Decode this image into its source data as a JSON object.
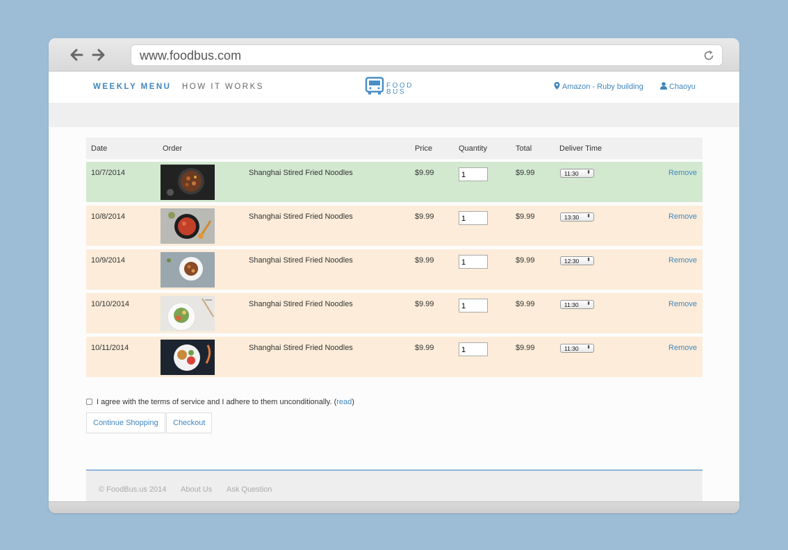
{
  "browser": {
    "url": "www.foodbus.com"
  },
  "header": {
    "menu_weekly": "WEEKLY MENU",
    "menu_how": "HOW IT WORKS",
    "logo_line1": "FOOD",
    "logo_line2": "BUS",
    "location": "Amazon - Ruby building",
    "user": "Chaoyu"
  },
  "table": {
    "headers": {
      "date": "Date",
      "order": "Order",
      "price": "Price",
      "quantity": "Quantity",
      "total": "Total",
      "deliver_time": "Deliver Time"
    },
    "rows": [
      {
        "date": "10/7/2014",
        "item": "Shanghai Stired Fried Noodles",
        "price": "$9.99",
        "qty": "1",
        "total": "$9.99",
        "time": "11:30",
        "remove": "Remove"
      },
      {
        "date": "10/8/2014",
        "item": "Shanghai Stired Fried Noodles",
        "price": "$9.99",
        "qty": "1",
        "total": "$9.99",
        "time": "13:30",
        "remove": "Remove"
      },
      {
        "date": "10/9/2014",
        "item": "Shanghai Stired Fried Noodles",
        "price": "$9.99",
        "qty": "1",
        "total": "$9.99",
        "time": "12:30",
        "remove": "Remove"
      },
      {
        "date": "10/10/2014",
        "item": "Shanghai Stired Fried Noodles",
        "price": "$9.99",
        "qty": "1",
        "total": "$9.99",
        "time": "11:30",
        "remove": "Remove"
      },
      {
        "date": "10/11/2014",
        "item": "Shanghai Stired Fried Noodles",
        "price": "$9.99",
        "qty": "1",
        "total": "$9.99",
        "time": "11:30",
        "remove": "Remove"
      }
    ]
  },
  "terms": {
    "text": "I agree with the terms of service and I adhere to them unconditionally. (",
    "link": "read",
    "close": ")"
  },
  "buttons": {
    "continue": "Continue Shopping",
    "checkout": "Checkout"
  },
  "footer": {
    "copyright": "© FoodBus.us 2014",
    "about": "About Us",
    "ask": "Ask Question"
  },
  "colors": {
    "accent": "#3f86bd",
    "row_highlight": "#d2e9d0",
    "row_default": "#fcecd9",
    "background": "#9dbdd6"
  }
}
